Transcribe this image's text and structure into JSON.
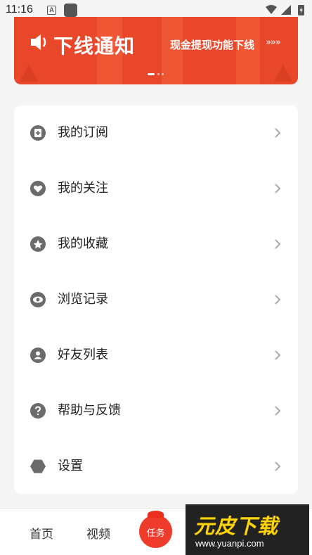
{
  "status_bar": {
    "time": "11:16",
    "notification_badge": "A"
  },
  "banner": {
    "title": "下线通知",
    "subtitle": "现金提现功能下线",
    "arrows": "»»»",
    "page_index": 1,
    "page_count": 3,
    "bg_color": "#e8472a"
  },
  "menu": {
    "items": [
      {
        "label": "我的订阅",
        "icon": "subscription-icon"
      },
      {
        "label": "我的关注",
        "icon": "heart-icon"
      },
      {
        "label": "我的收藏",
        "icon": "star-icon"
      },
      {
        "label": "浏览记录",
        "icon": "eye-icon"
      },
      {
        "label": "好友列表",
        "icon": "person-icon"
      },
      {
        "label": "帮助与反馈",
        "icon": "question-icon"
      },
      {
        "label": "设置",
        "icon": "settings-hex-icon"
      }
    ]
  },
  "tabbar": {
    "home": "首页",
    "video": "视频",
    "task": "任务",
    "accent": "#ef3b2c"
  },
  "watermark": {
    "brand": "元皮下载",
    "url": "www.yuanpi.com"
  }
}
